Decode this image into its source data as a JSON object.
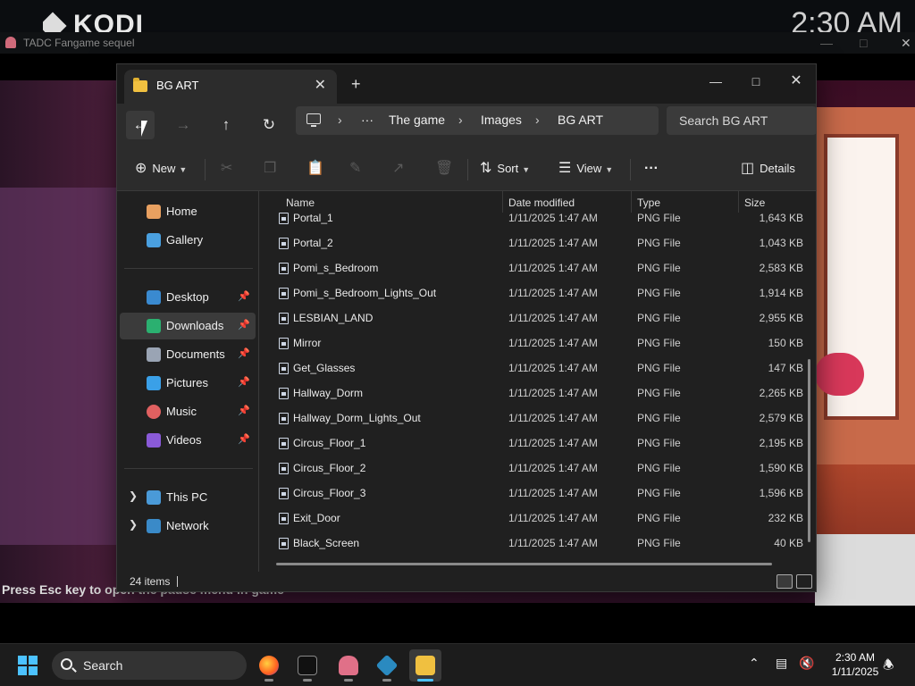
{
  "background": {
    "kodi_logo": "KODI",
    "kodi_clock": "2:30 AM",
    "app_title": "TADC Fangame sequel",
    "pause_hint": "Press Esc key to open the pause menu in game"
  },
  "explorer": {
    "tab_title": "BG ART",
    "breadcrumb": [
      "The game",
      "Images",
      "BG ART"
    ],
    "breadcrumb_overflow": "···",
    "search_placeholder": "Search BG ART",
    "toolbar": {
      "new_label": "New",
      "sort_label": "Sort",
      "view_label": "View",
      "more_label": "···",
      "details_label": "Details"
    },
    "sidebar": {
      "home": "Home",
      "gallery": "Gallery",
      "desktop": "Desktop",
      "downloads": "Downloads",
      "documents": "Documents",
      "pictures": "Pictures",
      "music": "Music",
      "videos": "Videos",
      "this_pc": "This PC",
      "network": "Network"
    },
    "columns": {
      "name": "Name",
      "date": "Date modified",
      "type": "Type",
      "size": "Size"
    },
    "files": [
      {
        "name": "Portal_1",
        "date": "1/11/2025 1:47 AM",
        "type": "PNG File",
        "size": "1,643 KB"
      },
      {
        "name": "Portal_2",
        "date": "1/11/2025 1:47 AM",
        "type": "PNG File",
        "size": "1,043 KB"
      },
      {
        "name": "Pomi_s_Bedroom",
        "date": "1/11/2025 1:47 AM",
        "type": "PNG File",
        "size": "2,583 KB"
      },
      {
        "name": "Pomi_s_Bedroom_Lights_Out",
        "date": "1/11/2025 1:47 AM",
        "type": "PNG File",
        "size": "1,914 KB"
      },
      {
        "name": "LESBIAN_LAND",
        "date": "1/11/2025 1:47 AM",
        "type": "PNG File",
        "size": "2,955 KB"
      },
      {
        "name": "Mirror",
        "date": "1/11/2025 1:47 AM",
        "type": "PNG File",
        "size": "150 KB"
      },
      {
        "name": "Get_Glasses",
        "date": "1/11/2025 1:47 AM",
        "type": "PNG File",
        "size": "147 KB"
      },
      {
        "name": "Hallway_Dorm",
        "date": "1/11/2025 1:47 AM",
        "type": "PNG File",
        "size": "2,265 KB"
      },
      {
        "name": "Hallway_Dorm_Lights_Out",
        "date": "1/11/2025 1:47 AM",
        "type": "PNG File",
        "size": "2,579 KB"
      },
      {
        "name": "Circus_Floor_1",
        "date": "1/11/2025 1:47 AM",
        "type": "PNG File",
        "size": "2,195 KB"
      },
      {
        "name": "Circus_Floor_2",
        "date": "1/11/2025 1:47 AM",
        "type": "PNG File",
        "size": "1,590 KB"
      },
      {
        "name": "Circus_Floor_3",
        "date": "1/11/2025 1:47 AM",
        "type": "PNG File",
        "size": "1,596 KB"
      },
      {
        "name": "Exit_Door",
        "date": "1/11/2025 1:47 AM",
        "type": "PNG File",
        "size": "232 KB"
      },
      {
        "name": "Black_Screen",
        "date": "1/11/2025 1:47 AM",
        "type": "PNG File",
        "size": "40 KB"
      }
    ],
    "status_count": "24 items"
  },
  "taskbar": {
    "search_placeholder": "Search",
    "time": "2:30 AM",
    "date": "1/11/2025"
  },
  "colors": {
    "accent": "#4cc2ff",
    "window_bg": "#202020",
    "folder_yellow": "#f0c040"
  }
}
